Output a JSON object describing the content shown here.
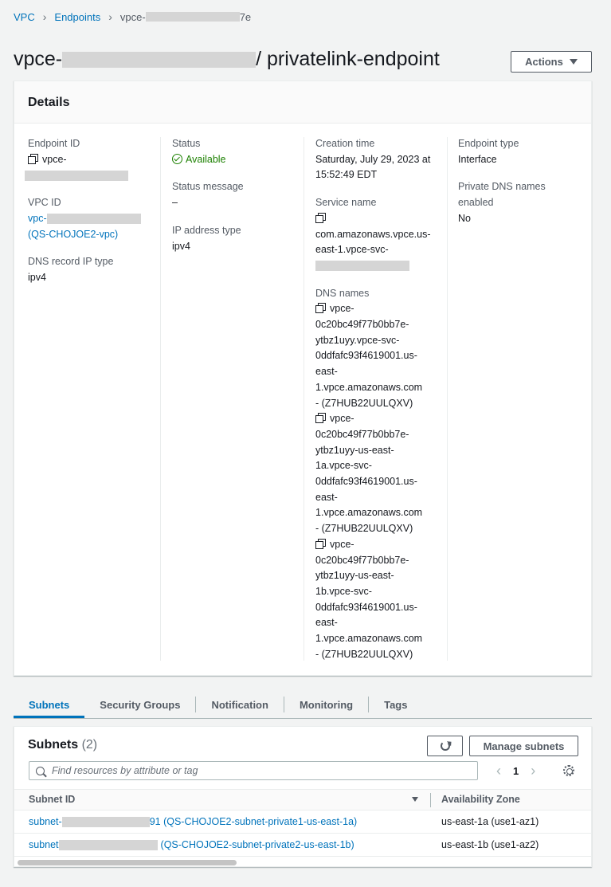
{
  "breadcrumb": {
    "vpc": "VPC",
    "endpoints": "Endpoints",
    "current_prefix": "vpce-",
    "current_suffix": "7e"
  },
  "header": {
    "title_prefix": "vpce-",
    "title_suffix": "/ privatelink-endpoint",
    "actions_label": "Actions"
  },
  "details": {
    "heading": "Details",
    "endpoint_id": {
      "label": "Endpoint ID",
      "value": "vpce-"
    },
    "vpc_id": {
      "label": "VPC ID",
      "value_prefix": "vpc-",
      "value_name": "(QS-CHOJOE2-vpc)"
    },
    "dns_record_ip_type": {
      "label": "DNS record IP type",
      "value": "ipv4"
    },
    "status": {
      "label": "Status",
      "value": "Available",
      "color": "#1d8102"
    },
    "status_message": {
      "label": "Status message",
      "value": "–"
    },
    "ip_address_type": {
      "label": "IP address type",
      "value": "ipv4"
    },
    "creation_time": {
      "label": "Creation time",
      "value_line1": "Saturday, July 29, 2023 at",
      "value_line2": "15:52:49 EDT"
    },
    "service_name": {
      "label": "Service name",
      "value_line1": "com.amazonaws.vpce.us-",
      "value_line2": "east-1.vpce-svc-"
    },
    "dns_names": {
      "label": "DNS names",
      "entries": [
        [
          "vpce-",
          "0c20bc49f77b0bb7e-",
          "ytbz1uyy.vpce-svc-",
          "0ddfafc93f4619001.us-",
          "east-",
          "1.vpce.amazonaws.com",
          "- (Z7HUB22UULQXV)"
        ],
        [
          "vpce-",
          "0c20bc49f77b0bb7e-",
          "ytbz1uyy-us-east-",
          "1a.vpce-svc-",
          "0ddfafc93f4619001.us-",
          "east-",
          "1.vpce.amazonaws.com",
          "- (Z7HUB22UULQXV)"
        ],
        [
          "vpce-",
          "0c20bc49f77b0bb7e-",
          "ytbz1uyy-us-east-",
          "1b.vpce-svc-",
          "0ddfafc93f4619001.us-",
          "east-",
          "1.vpce.amazonaws.com",
          "- (Z7HUB22UULQXV)"
        ]
      ]
    },
    "endpoint_type": {
      "label": "Endpoint type",
      "value": "Interface"
    },
    "private_dns": {
      "label_line1": "Private DNS names",
      "label_line2": "enabled",
      "value": "No"
    }
  },
  "tabs": [
    "Subnets",
    "Security Groups",
    "Notification",
    "Monitoring",
    "Tags"
  ],
  "subnets": {
    "title": "Subnets",
    "count": "(2)",
    "manage_label": "Manage subnets",
    "search_placeholder": "Find resources by attribute or tag",
    "page": "1",
    "col_subnet": "Subnet ID",
    "col_az": "Availability Zone",
    "rows": [
      {
        "id_prefix": "subnet-",
        "id_suffix": "91 (QS-CHOJOE2-subnet-private1-us-east-1a)",
        "az": "us-east-1a (use1-az1)"
      },
      {
        "id_prefix": "subnet",
        "id_suffix": "(QS-CHOJOE2-subnet-private2-us-east-1b)",
        "az": "us-east-1b (use1-az2)"
      }
    ]
  }
}
